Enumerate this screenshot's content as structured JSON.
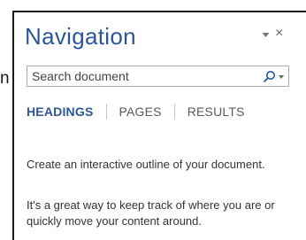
{
  "margin_text": "n",
  "panel": {
    "title": "Navigation",
    "pin_icon": "triangle-down-icon",
    "close_glyph": "×"
  },
  "search": {
    "placeholder": "Search document",
    "icon": "search-icon",
    "dropdown_icon": "chevron-down-icon"
  },
  "tabs": [
    {
      "label": "HEADINGS",
      "active": true
    },
    {
      "label": "PAGES",
      "active": false
    },
    {
      "label": "RESULTS",
      "active": false
    }
  ],
  "messages": {
    "line1": "Create an interactive outline of your document.",
    "line2": "It's a great way to keep track of where you are or quickly move your content around."
  },
  "colors": {
    "accent": "#2b579a",
    "text": "#333333",
    "border": "#ababab"
  }
}
